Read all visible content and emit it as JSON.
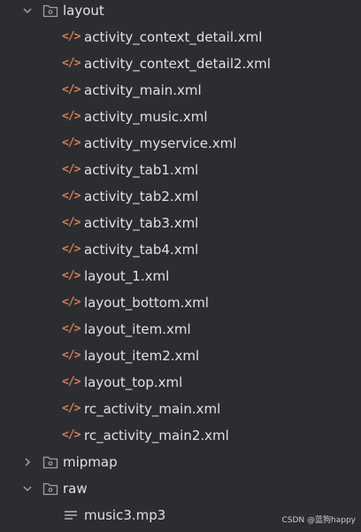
{
  "tree": {
    "layout_folder": {
      "label": "layout",
      "expanded": true,
      "icon": "folder-icon"
    },
    "layout_files": [
      {
        "label": "activity_context_detail.xml",
        "icon": "xml-file-icon"
      },
      {
        "label": "activity_context_detail2.xml",
        "icon": "xml-file-icon"
      },
      {
        "label": "activity_main.xml",
        "icon": "xml-file-icon"
      },
      {
        "label": "activity_music.xml",
        "icon": "xml-file-icon"
      },
      {
        "label": "activity_myservice.xml",
        "icon": "xml-file-icon"
      },
      {
        "label": "activity_tab1.xml",
        "icon": "xml-file-icon"
      },
      {
        "label": "activity_tab2.xml",
        "icon": "xml-file-icon"
      },
      {
        "label": "activity_tab3.xml",
        "icon": "xml-file-icon"
      },
      {
        "label": "activity_tab4.xml",
        "icon": "xml-file-icon"
      },
      {
        "label": "layout_1.xml",
        "icon": "xml-file-icon"
      },
      {
        "label": "layout_bottom.xml",
        "icon": "xml-file-icon"
      },
      {
        "label": "layout_item.xml",
        "icon": "xml-file-icon"
      },
      {
        "label": "layout_item2.xml",
        "icon": "xml-file-icon"
      },
      {
        "label": "layout_top.xml",
        "icon": "xml-file-icon"
      },
      {
        "label": "rc_activity_main.xml",
        "icon": "xml-file-icon"
      },
      {
        "label": "rc_activity_main2.xml",
        "icon": "xml-file-icon"
      }
    ],
    "mipmap_folder": {
      "label": "mipmap",
      "expanded": false,
      "icon": "folder-icon"
    },
    "raw_folder": {
      "label": "raw",
      "expanded": true,
      "icon": "folder-icon"
    },
    "raw_files": [
      {
        "label": "music3.mp3",
        "icon": "text-file-icon"
      }
    ]
  },
  "xml_icon_glyph": "</>",
  "watermark": "CSDN @蓝狗happy",
  "colors": {
    "background": "#2b2d30",
    "text": "#dfe1e5",
    "xml_icon": "#d97b55",
    "chevron": "#9da0a8",
    "folder_outline": "#9da0a8"
  }
}
